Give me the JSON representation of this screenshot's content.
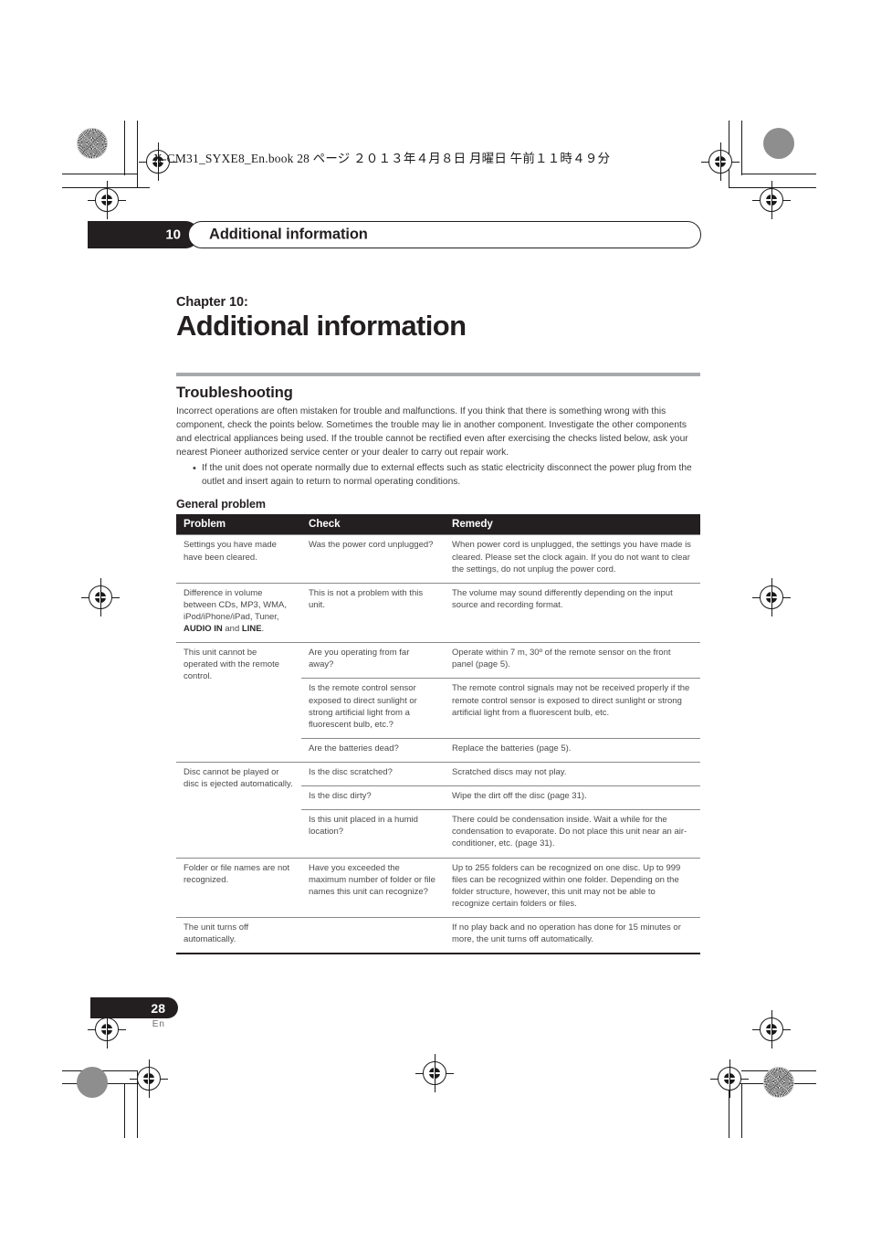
{
  "slug": {
    "text": "X-CM31_SYXE8_En.book   28 ページ   ２０１３年４月８日   月曜日   午前１１時４９分"
  },
  "running_header": {
    "chapter_number": "10",
    "chapter_title": "Additional information"
  },
  "chapter": {
    "label": "Chapter 10:",
    "title": "Additional information"
  },
  "section": {
    "heading": "Troubleshooting",
    "intro": "Incorrect operations are often mistaken for trouble and malfunctions. If you think that there is something wrong with this component, check the points below. Sometimes the trouble may lie in another component. Investigate the other components and electrical appliances being used. If the trouble cannot be rectified even after exercising the checks listed below, ask your nearest Pioneer authorized service center or your dealer to carry out repair work.",
    "bullets": [
      "If the unit does not operate normally due to external effects such as static electricity disconnect the power plug from the outlet and insert again to return to normal operating conditions."
    ],
    "subheading": "General problem"
  },
  "table": {
    "headers": {
      "problem": "Problem",
      "check": "Check",
      "remedy": "Remedy"
    },
    "rows": [
      {
        "problem": "Settings you have made have been cleared.",
        "check": "Was the power cord unplugged?",
        "remedy": "When power cord is unplugged, the settings you have made is cleared. Please set the clock again. If you do not want to clear the settings, do not unplug the power cord."
      },
      {
        "problem_prefix": "Difference in volume between CDs, MP3, WMA, iPod/iPhone/iPad, Tuner, ",
        "problem_bold1": "AUDIO IN",
        "problem_mid": " and ",
        "problem_bold2": "LINE",
        "problem_suffix": ".",
        "check": "This is not a problem with this unit.",
        "remedy": "The volume may sound differently depending on the input source and recording format."
      },
      {
        "problem": "This unit cannot be operated with the remote control.",
        "check": "Are you operating from far away?",
        "remedy": "Operate within 7 m, 30º of the remote sensor on the front panel (page 5)."
      },
      {
        "problem": "",
        "check": "Is the remote control sensor exposed to direct sunlight or strong artificial light from a fluorescent bulb, etc.?",
        "remedy": "The remote control signals may not be received properly if the remote control sensor is exposed to direct sunlight or strong artificial light from a fluorescent bulb, etc."
      },
      {
        "problem": "",
        "check": "Are the batteries dead?",
        "remedy": "Replace the batteries (page 5)."
      },
      {
        "problem": "Disc cannot be played or disc is ejected automatically.",
        "check": "Is the disc scratched?",
        "remedy": "Scratched discs may not play."
      },
      {
        "problem": "",
        "check": "Is the disc dirty?",
        "remedy": "Wipe the dirt off the disc (page 31)."
      },
      {
        "problem": "",
        "check": "Is this unit placed in a humid location?",
        "remedy": "There could be condensation inside. Wait a while for the condensation to evaporate. Do not place this unit near an air-conditioner, etc. (page 31)."
      },
      {
        "problem": "Folder or file names are not recognized.",
        "check": "Have you exceeded the maximum number of folder or file names this unit can recognize?",
        "remedy": "Up to 255 folders can be recognized on one disc. Up to 999 files can be recognized within one folder. Depending on the folder structure, however, this unit may not be able to recognize certain folders or files."
      },
      {
        "problem": "The unit turns off automatically.",
        "check": "",
        "remedy": "If no play back and no operation has done for 15 minutes or more, the unit turns off automatically."
      }
    ]
  },
  "folio": {
    "page_number": "28",
    "language": "En"
  }
}
